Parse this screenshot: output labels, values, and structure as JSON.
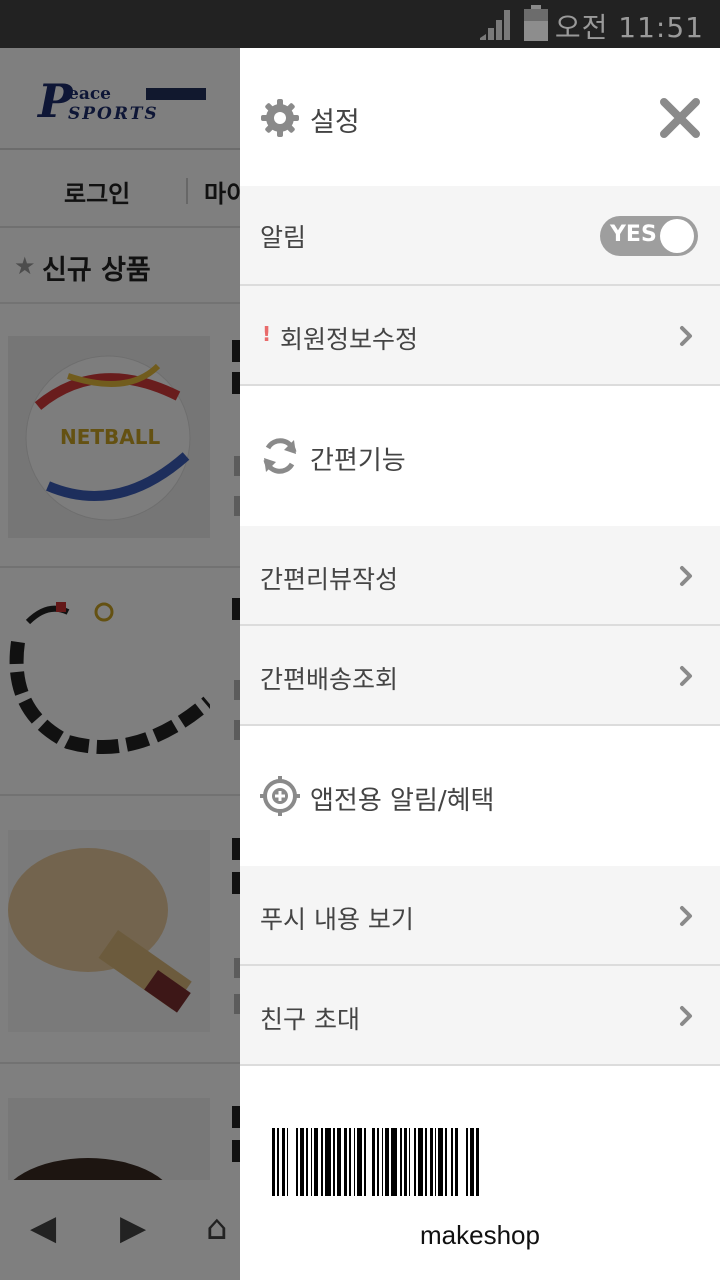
{
  "status_bar": {
    "time": "오전 11:51",
    "icons": [
      "signal-icon",
      "battery-icon"
    ]
  },
  "background_page": {
    "logo": {
      "letter": "P",
      "line1": "eace",
      "line2": "SPORTS"
    },
    "nav": {
      "login": "로그인",
      "mypage": "마이"
    },
    "section_title": "신규 상품",
    "products": [
      "netball",
      "rope",
      "paddle",
      "paddle-2"
    ]
  },
  "drawer": {
    "header": {
      "title": "설정",
      "icon": "gear-icon",
      "close_icon": "close-icon"
    },
    "notification": {
      "label": "알림",
      "toggle_text": "YES",
      "on": true
    },
    "member_edit": {
      "label": "회원정보수정",
      "marker": "!"
    },
    "quick_section": {
      "label": "간편기능",
      "icon": "refresh-icon"
    },
    "quick_items": [
      {
        "label": "간편리뷰작성"
      },
      {
        "label": "간편배송조회"
      }
    ],
    "app_section": {
      "label": "앱전용 알림/혜택",
      "icon": "target-plus-icon"
    },
    "app_items": [
      {
        "label": "푸시 내용 보기"
      },
      {
        "label": "친구 초대"
      }
    ],
    "barcode": {
      "text": "makeshop"
    }
  },
  "colors": {
    "statusbar": "#222222",
    "drawer_row_bg": "#f5f5f5",
    "toggle_bg": "#9e9e9e",
    "icon_gray": "#8a8a8a",
    "marker_red": "#e96b6b"
  }
}
